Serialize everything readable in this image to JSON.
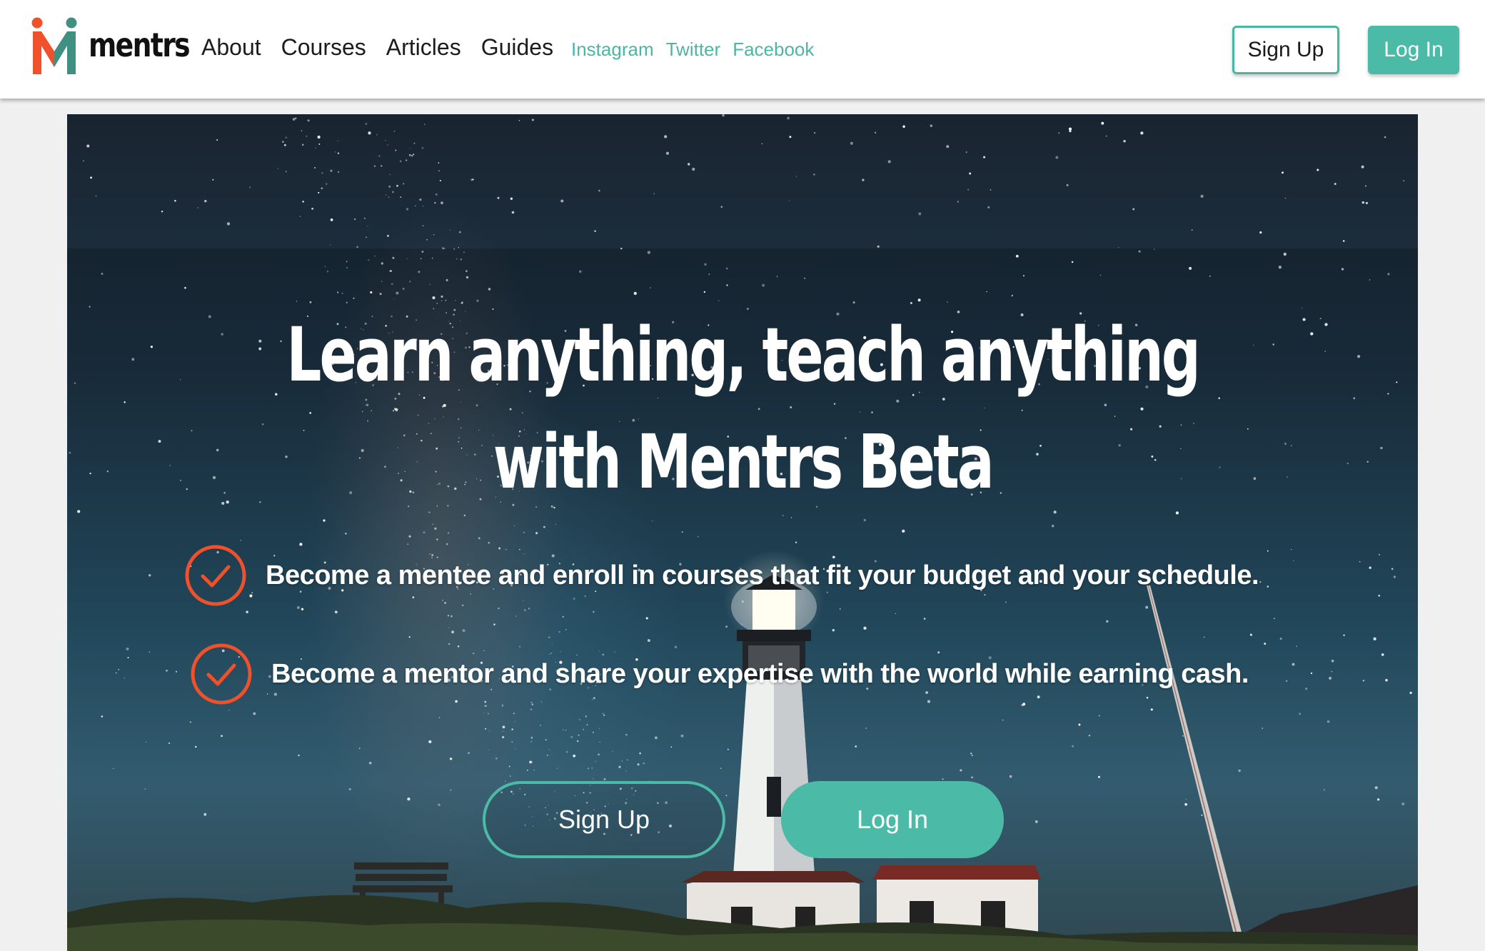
{
  "header": {
    "logo_text": "mentrs",
    "nav": [
      {
        "label": "About"
      },
      {
        "label": "Courses"
      },
      {
        "label": "Articles"
      },
      {
        "label": "Guides"
      }
    ],
    "social": [
      {
        "label": "Instagram"
      },
      {
        "label": "Twitter"
      },
      {
        "label": "Facebook"
      }
    ],
    "signup_label": "Sign Up",
    "login_label": "Log In"
  },
  "hero": {
    "headline_line1": "Learn anything, teach anything",
    "headline_line2": "with Mentrs Beta",
    "features": [
      {
        "text": "Become a mentee and enroll in courses that fit your budget and your schedule."
      },
      {
        "text": "Become a mentor and share your expertise with the world while earning cash."
      }
    ],
    "signup_label": "Sign Up",
    "login_label": "Log In"
  },
  "icons": {
    "logo": "mentrs-logo-mark",
    "feature_check": "check-circle-icon"
  },
  "colors": {
    "brand_teal": "#4bbba8",
    "brand_orange": "#f0502a",
    "header_bg": "#ffffff",
    "page_bg": "#f0f0f0"
  }
}
